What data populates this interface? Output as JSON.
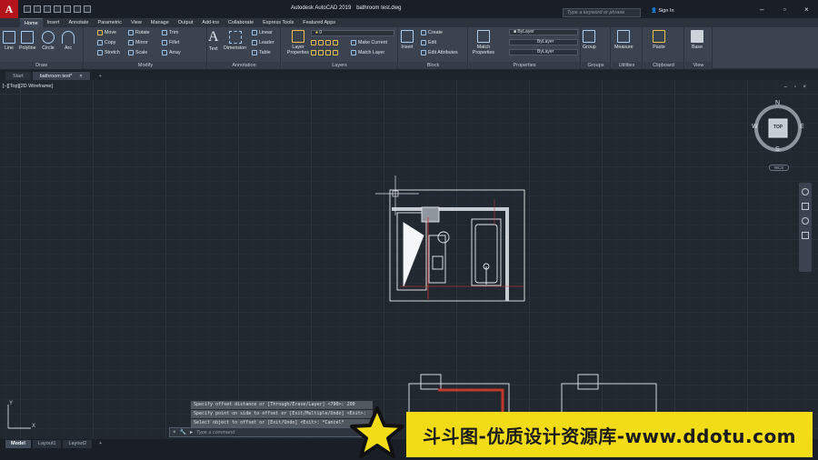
{
  "titlebar": {
    "app_name": "Autodesk AutoCAD 2019",
    "file_name": "bathroom test.dwg",
    "search_placeholder": "Type a keyword or phrase",
    "sign_in": "Sign In"
  },
  "ribbon_tabs": [
    "Home",
    "Insert",
    "Annotate",
    "Parametric",
    "View",
    "Manage",
    "Output",
    "Add-ins",
    "Collaborate",
    "Express Tools",
    "Featured Apps"
  ],
  "ribbon": {
    "draw": {
      "title": "Draw",
      "tools": [
        "Line",
        "Polyline",
        "Circle",
        "Arc"
      ]
    },
    "modify": {
      "title": "Modify",
      "tools": [
        "Move",
        "Rotate",
        "Trim",
        "Copy",
        "Mirror",
        "Fillet",
        "Stretch",
        "Scale",
        "Array"
      ]
    },
    "annotation": {
      "title": "Annotation",
      "tools": [
        "Text",
        "Dimension",
        "Linear",
        "Leader",
        "Table"
      ]
    },
    "layers": {
      "title": "Layers",
      "tools": [
        "Layer Properties",
        "Make Current",
        "Match Layer"
      ],
      "current_layer": "0"
    },
    "block": {
      "title": "Block",
      "tools": [
        "Insert",
        "Create",
        "Edit",
        "Edit Attributes"
      ]
    },
    "properties": {
      "title": "Properties",
      "tools": [
        "Match Properties"
      ],
      "color": "ByLayer",
      "linetype": "ByLayer",
      "lineweight": "ByLayer"
    },
    "groups": {
      "title": "Groups",
      "tools": [
        "Group"
      ]
    },
    "utilities": {
      "title": "Utilities",
      "tools": [
        "Measure"
      ]
    },
    "clipboard": {
      "title": "Clipboard",
      "tools": [
        "Paste"
      ]
    },
    "view": {
      "title": "View",
      "tools": [
        "Base"
      ]
    }
  },
  "file_tabs": [
    "Start",
    "bathroom test*"
  ],
  "viewport": {
    "label": "[–][Top][2D Wireframe]",
    "controls": "– ▫ ×"
  },
  "viewcube": {
    "north": "N",
    "south": "S",
    "east": "E",
    "west": "W",
    "face": "TOP",
    "wcs": "WCS"
  },
  "ucs": {
    "x": "X",
    "y": "Y"
  },
  "command": {
    "history": [
      "Specify offset distance or [Through/Erase/Layer] <790>: 200",
      "Specify point on side to offset or [Exit/Multiple/Undo] <Exit>:",
      "Select object to offset or [Exit/Undo] <Exit>: *Cancel*"
    ],
    "prompt": "Type a command"
  },
  "layout_tabs": [
    "Model",
    "Layout1",
    "Layout2"
  ],
  "watermark": {
    "text": "斗斗图-优质设计资源库-www.ddotu.com"
  },
  "colors": {
    "background": "#212830",
    "ribbon": "#3b4350",
    "watermark_bg": "#f2dc17"
  }
}
